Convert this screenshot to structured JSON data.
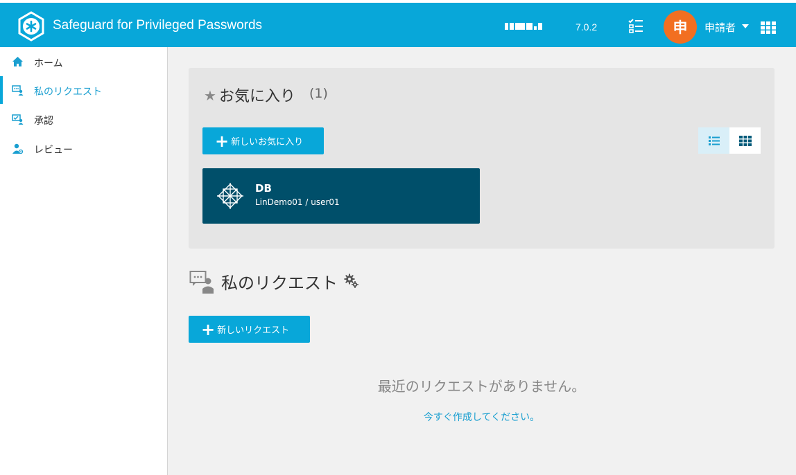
{
  "header": {
    "app_title": "Safeguard for Privileged Passwords",
    "version": "7.0.2",
    "user": {
      "avatar_char": "申",
      "name": "申請者"
    }
  },
  "sidebar": {
    "items": [
      {
        "label": "ホーム",
        "icon": "home-icon",
        "active": false
      },
      {
        "label": "私のリクエスト",
        "icon": "request-icon",
        "active": true
      },
      {
        "label": "承認",
        "icon": "approval-icon",
        "active": false
      },
      {
        "label": "レビュー",
        "icon": "review-icon",
        "active": false
      }
    ]
  },
  "favorites": {
    "title": "お気に入り",
    "count": "(1)",
    "new_button": "新しいお気に入り",
    "cards": [
      {
        "name": "DB",
        "subtitle": "LinDemo01 / user01"
      }
    ]
  },
  "requests": {
    "title": "私のリクエスト",
    "new_button": "新しいリクエスト",
    "empty_message": "最近のリクエストがありません。",
    "create_link": "今すぐ作成してください。"
  },
  "colors": {
    "header_bg": "#08a7d9",
    "accent": "#08a7d9",
    "avatar_bg": "#f26f21",
    "card_bg": "#004f6a"
  }
}
